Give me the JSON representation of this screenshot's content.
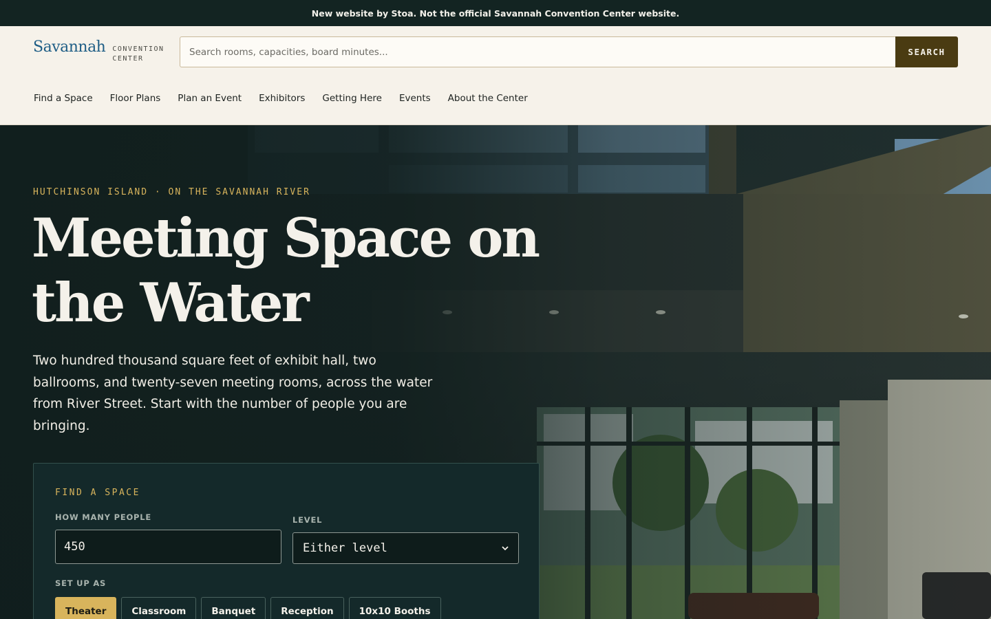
{
  "notice": "New website by Stoa. Not the official Savannah Convention Center website.",
  "logo": {
    "main": "Savannah",
    "sub_line1": "Convention",
    "sub_line2": "Center"
  },
  "search": {
    "placeholder": "Search rooms, capacities, board minutes...",
    "button_label": "SEARCH"
  },
  "nav": [
    "Find a Space",
    "Floor Plans",
    "Plan an Event",
    "Exhibitors",
    "Getting Here",
    "Events",
    "About the Center"
  ],
  "hero": {
    "eyebrow": "Hutchinson Island · On the Savannah River",
    "headline_line1": "Meeting Space on",
    "headline_line2": "the Water",
    "lede": "Two hundred thousand square feet of exhibit hall, two ballrooms, and twenty-seven meeting rooms, across the water from River Street. Start with the number of people you are bringing."
  },
  "finder": {
    "title": "Find a Space",
    "people_label": "How many people",
    "people_value": "450",
    "level_label": "Level",
    "level_value": "Either level",
    "setup_label": "Set up as",
    "setups": [
      "Theater",
      "Classroom",
      "Banquet",
      "Reception",
      "10x10 Booths"
    ],
    "active_setup": "Theater"
  },
  "colors": {
    "accent_gold": "#d8b45c",
    "brand_blue": "#1f5e86",
    "search_button": "#4a3b12",
    "dark_teal": "#14292a"
  }
}
